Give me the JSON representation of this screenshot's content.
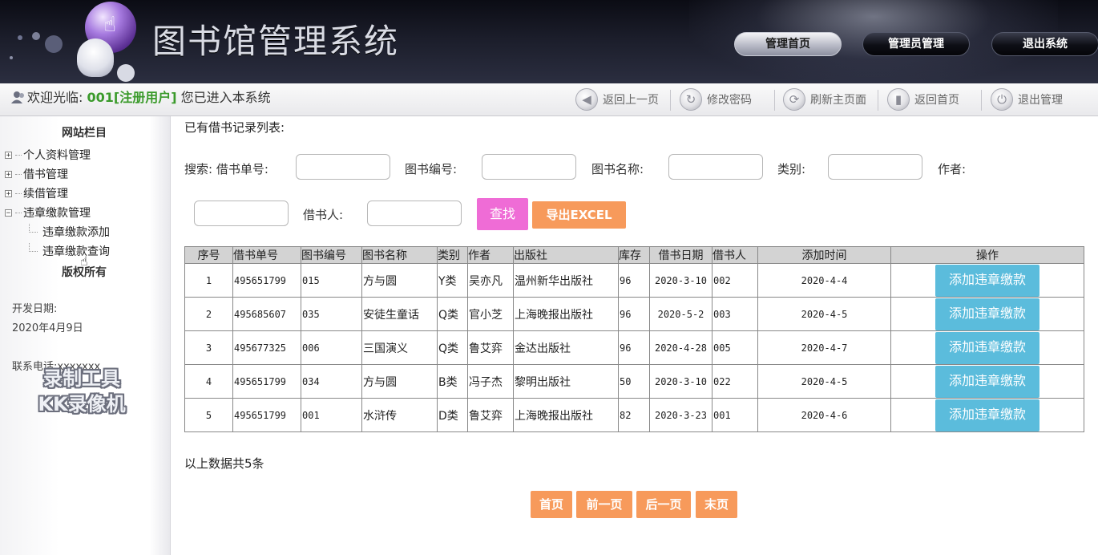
{
  "header": {
    "title": "图书馆管理系统",
    "nav": [
      "管理首页",
      "管理员管理",
      "退出系统"
    ]
  },
  "toolbar": {
    "welcome_prefix": "欢迎光临:",
    "user": "001[注册用户]",
    "welcome_suffix": "您已进入本系统",
    "tools": [
      {
        "label": "返回上一页",
        "icon": "back-icon"
      },
      {
        "label": "修改密码",
        "icon": "key-icon"
      },
      {
        "label": "刷新主页面",
        "icon": "refresh-icon"
      },
      {
        "label": "返回首页",
        "icon": "home-icon"
      },
      {
        "label": "退出管理",
        "icon": "power-icon"
      }
    ]
  },
  "sidebar": {
    "title": "网站栏目",
    "items": [
      "个人资料管理",
      "借书管理",
      "续借管理",
      "违章缴款管理"
    ],
    "sub_items": [
      "违章缴款添加",
      "违章缴款查询"
    ],
    "copyright": "版权所有",
    "dev_date_label": "开发日期:",
    "dev_date": "2020年4月9日",
    "contact": "联系电话:xxxxxxx",
    "watermark": [
      "录制工具",
      "KK录像机"
    ]
  },
  "main": {
    "list_title": "已有借书记录列表:",
    "search": {
      "label_prefix": "搜索:",
      "fields": [
        "借书单号:",
        "图书编号:",
        "图书名称:",
        "类别:",
        "作者:",
        "借书人:"
      ],
      "search_button": "查找",
      "export_button": "导出EXCEL"
    },
    "table": {
      "headers": [
        "序号",
        "借书单号",
        "图书编号",
        "图书名称",
        "类别",
        "作者",
        "出版社",
        "库存",
        "借书日期",
        "借书人",
        "添加时间",
        "操作"
      ],
      "rows": [
        [
          "1",
          "495651799",
          "015",
          "方与圆",
          "Y类",
          "吴亦凡",
          "温州新华出版社",
          "96",
          "2020-3-10",
          "002",
          "2020-4-4"
        ],
        [
          "2",
          "495685607",
          "035",
          "安徒生童话",
          "Q类",
          "官小芝",
          "上海晚报出版社",
          "96",
          "2020-5-2",
          "003",
          "2020-4-5"
        ],
        [
          "3",
          "495677325",
          "006",
          "三国演义",
          "Q类",
          "鲁艾弈",
          "金达出版社",
          "96",
          "2020-4-28",
          "005",
          "2020-4-7"
        ],
        [
          "4",
          "495651799",
          "034",
          "方与圆",
          "B类",
          "冯子杰",
          "黎明出版社",
          "50",
          "2020-3-10",
          "022",
          "2020-4-5"
        ],
        [
          "5",
          "495651799",
          "001",
          "水浒传",
          "D类",
          "鲁艾弈",
          "上海晚报出版社",
          "82",
          "2020-3-23",
          "001",
          "2020-4-6"
        ]
      ],
      "action_label": "添加违章缴款"
    },
    "total_text": "以上数据共5条",
    "pager": [
      "首页",
      "前一页",
      "后一页",
      "末页"
    ]
  }
}
